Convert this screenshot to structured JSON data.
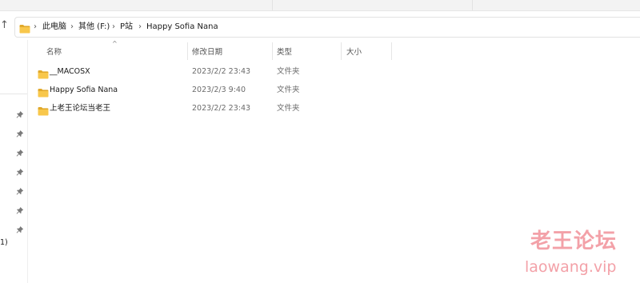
{
  "nav": {
    "up_label": "↑"
  },
  "address": {
    "crumbs": [
      "此电脑",
      "其他 (F:)",
      "P站",
      "Happy Sofia Nana"
    ],
    "separator": "›"
  },
  "columns": {
    "name": "名称",
    "date": "修改日期",
    "type": "类型",
    "size": "大小"
  },
  "files": [
    {
      "name": "__MACOSX",
      "date": "2023/2/2 23:43",
      "type": "文件夹",
      "size": ""
    },
    {
      "name": "Happy Sofia Nana",
      "date": "2023/2/3 9:40",
      "type": "文件夹",
      "size": ""
    },
    {
      "name": "上老王论坛当老王",
      "date": "2023/2/2 23:43",
      "type": "文件夹",
      "size": ""
    }
  ],
  "sidebar": {
    "drive_fragment": "1)",
    "pinned_count": 7
  },
  "watermark": {
    "title": "老王论坛",
    "url": "laowang.vip"
  },
  "colors": {
    "folder_yellow": "#f8c74b",
    "folder_dark": "#e1a92b",
    "watermark": "#f3a1a8"
  },
  "icons": {
    "folder": "folder-icon",
    "pin": "pin-icon",
    "up": "up-arrow-icon"
  }
}
